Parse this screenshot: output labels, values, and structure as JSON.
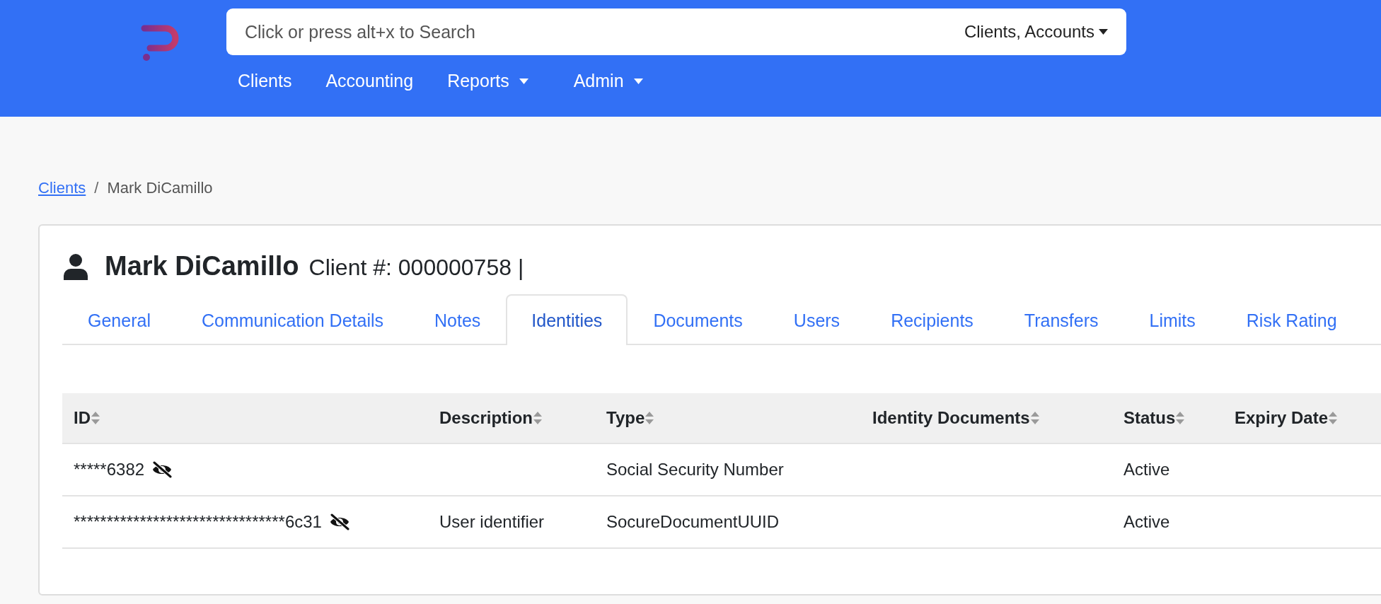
{
  "header": {
    "search": {
      "placeholder": "Click or press alt+x to Search",
      "scope": "Clients, Accounts"
    },
    "nav": [
      {
        "label": "Clients",
        "has_menu": false
      },
      {
        "label": "Accounting",
        "has_menu": false
      },
      {
        "label": "Reports",
        "has_menu": true
      },
      {
        "label": "Admin",
        "has_menu": true
      }
    ]
  },
  "breadcrumb": [
    {
      "label": "Clients",
      "kind": "link"
    },
    {
      "label": "/",
      "kind": "separator"
    },
    {
      "label": "Mark DiCamillo",
      "kind": "current"
    }
  ],
  "client": {
    "name": "Mark DiCamillo",
    "number": "Client #: 000000758 |"
  },
  "tabs": [
    {
      "label": "General",
      "selected": false
    },
    {
      "label": "Communication Details",
      "selected": false
    },
    {
      "label": "Notes",
      "selected": false
    },
    {
      "label": "Identities",
      "selected": true
    },
    {
      "label": "Documents",
      "selected": false
    },
    {
      "label": "Users",
      "selected": false
    },
    {
      "label": "Recipients",
      "selected": false
    },
    {
      "label": "Transfers",
      "selected": false
    },
    {
      "label": "Limits",
      "selected": false
    },
    {
      "label": "Risk Rating",
      "selected": false
    }
  ],
  "table": {
    "columns": [
      "ID",
      "Description",
      "Type",
      "Identity Documents",
      "Status",
      "Expiry Date"
    ],
    "rows": [
      {
        "id": "*****6382",
        "masked": true,
        "description": "",
        "type": "Social Security Number",
        "identity_documents": "",
        "status": "Active",
        "expiry_date": ""
      },
      {
        "id": "********************************6c31",
        "masked": true,
        "description": "User identifier",
        "type": "SocureDocumentUUID",
        "identity_documents": "",
        "status": "Active",
        "expiry_date": ""
      }
    ]
  }
}
